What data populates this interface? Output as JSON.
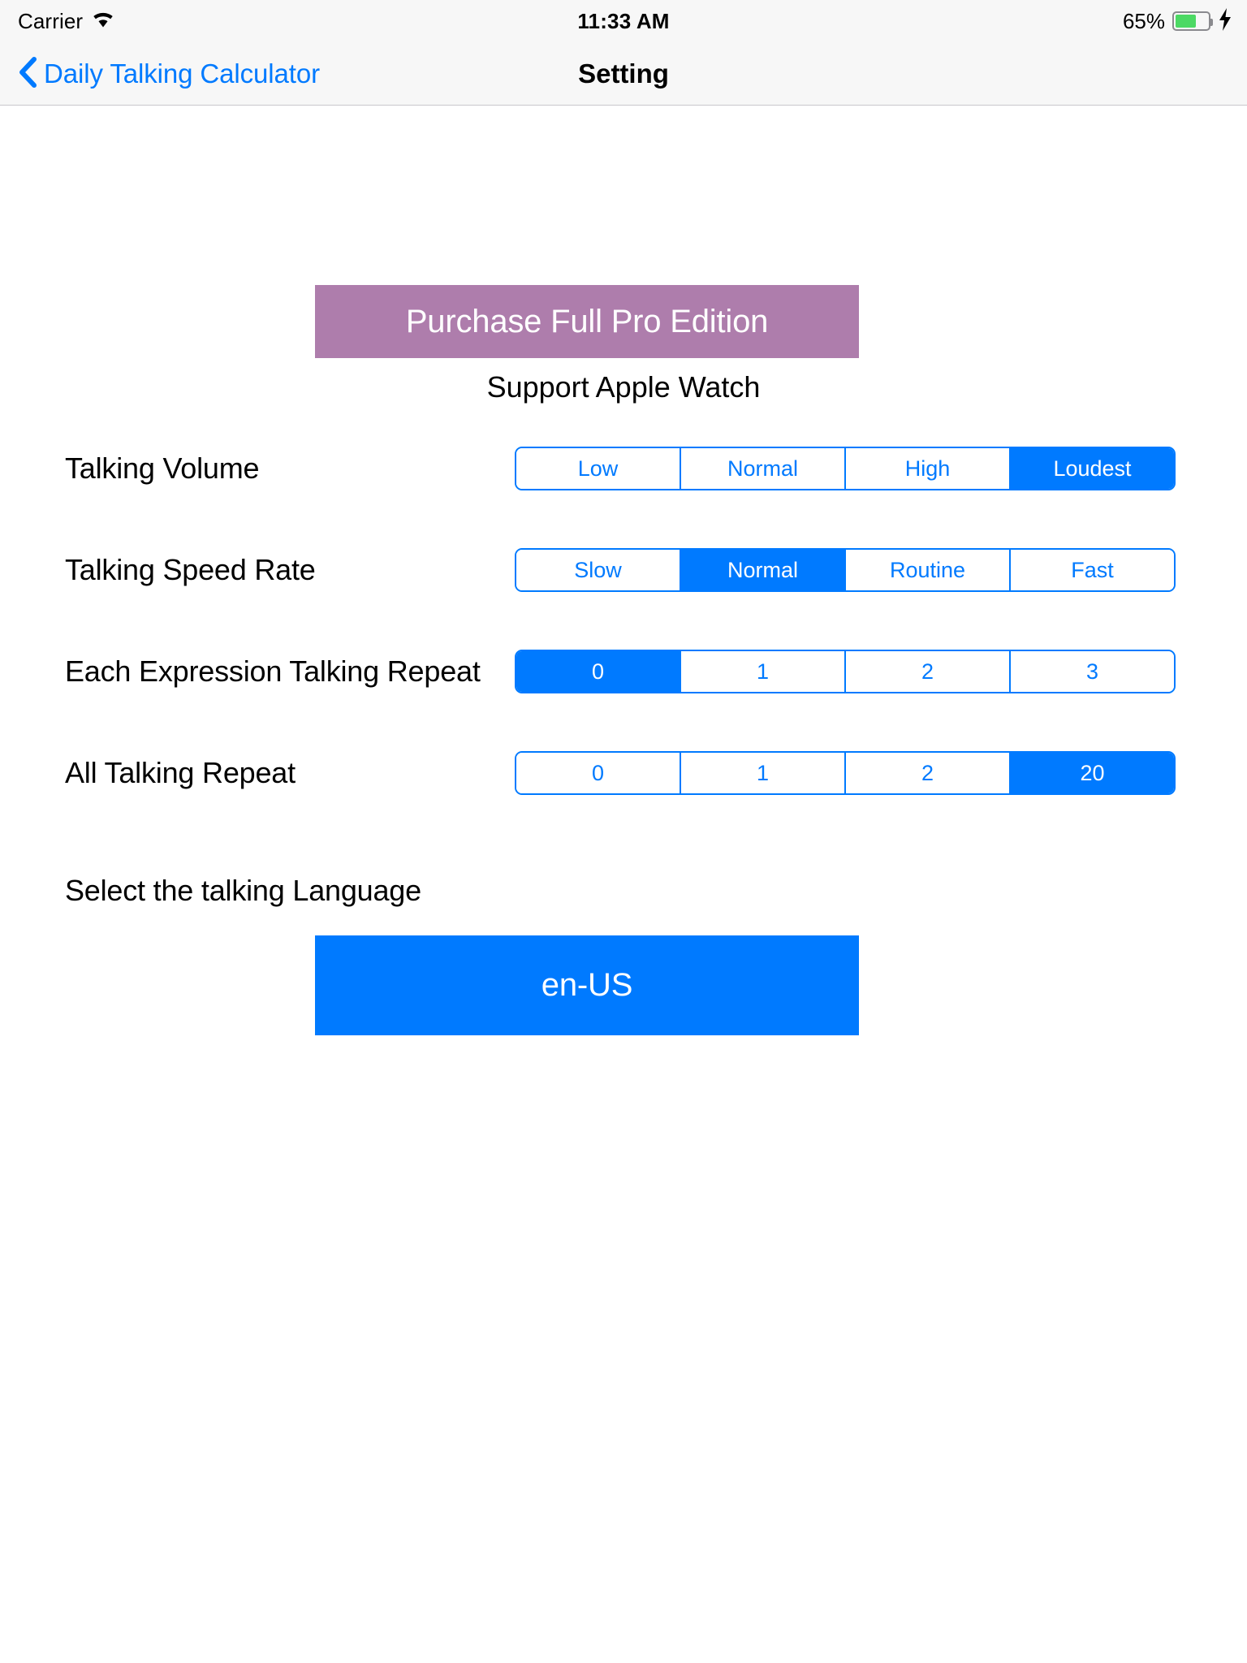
{
  "status_bar": {
    "carrier": "Carrier",
    "wifi_icon": "wifi-icon",
    "time": "11:33 AM",
    "battery_percent": "65%",
    "battery_level": 65,
    "battery_color": "#4CD964",
    "charging_icon": "bolt-icon"
  },
  "nav_bar": {
    "back_icon": "chevron-left-icon",
    "back_label": "Daily Talking Calculator",
    "title": "Setting",
    "tint_color": "#007AFF"
  },
  "main": {
    "purchase_button": {
      "label": "Purchase Full Pro Edition",
      "color": "#AE7DAC"
    },
    "watch_note": "Support Apple Watch",
    "accent_color": "#007AFF",
    "settings": [
      {
        "label": "Talking Volume",
        "options": [
          "Low",
          "Normal",
          "High",
          "Loudest"
        ],
        "selected_index": 3
      },
      {
        "label": "Talking Speed Rate",
        "options": [
          "Slow",
          "Normal",
          "Routine",
          "Fast"
        ],
        "selected_index": 1
      },
      {
        "label": "Each Expression Talking Repeat",
        "options": [
          "0",
          "1",
          "2",
          "3"
        ],
        "selected_index": 0
      },
      {
        "label": "All Talking Repeat",
        "options": [
          "0",
          "1",
          "2",
          "20"
        ],
        "selected_index": 3
      }
    ],
    "language_section": {
      "label": "Select the talking Language",
      "selected_language": "en-US"
    }
  }
}
